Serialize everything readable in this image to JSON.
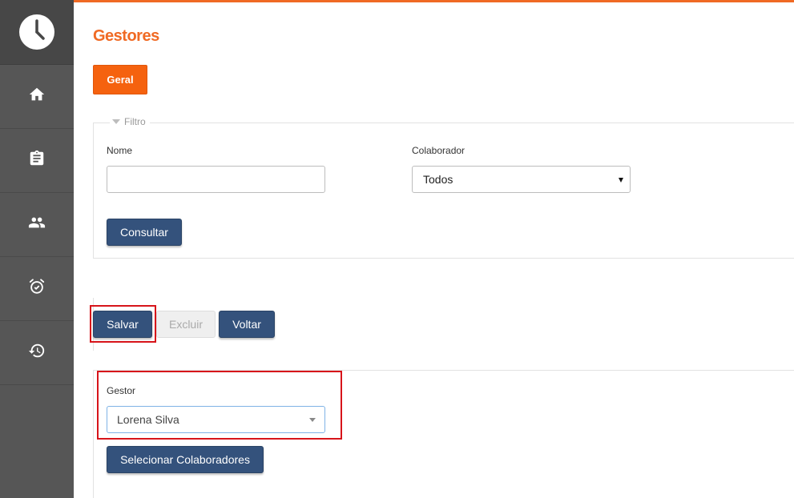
{
  "colors": {
    "accent": "#f06a24",
    "sidebar": "#565656",
    "primary_button": "#34527c",
    "highlight": "#d7141a"
  },
  "sidebar": {
    "logo_icon": "clock-icon",
    "items": [
      {
        "icon": "home-icon"
      },
      {
        "icon": "clipboard-icon"
      },
      {
        "icon": "people-icon"
      },
      {
        "icon": "alarm-clock-icon"
      },
      {
        "icon": "history-icon"
      }
    ]
  },
  "page": {
    "title": "Gestores",
    "tab_label": "Geral"
  },
  "filter": {
    "legend": "Filtro",
    "nome_label": "Nome",
    "nome_value": "",
    "colaborador_label": "Colaborador",
    "colaborador_value": "Todos",
    "consultar_label": "Consultar"
  },
  "actions": {
    "salvar_label": "Salvar",
    "excluir_label": "Excluir",
    "voltar_label": "Voltar"
  },
  "form": {
    "gestor_label": "Gestor",
    "gestor_value": "Lorena Silva",
    "selecionar_label": "Selecionar Colaboradores"
  }
}
